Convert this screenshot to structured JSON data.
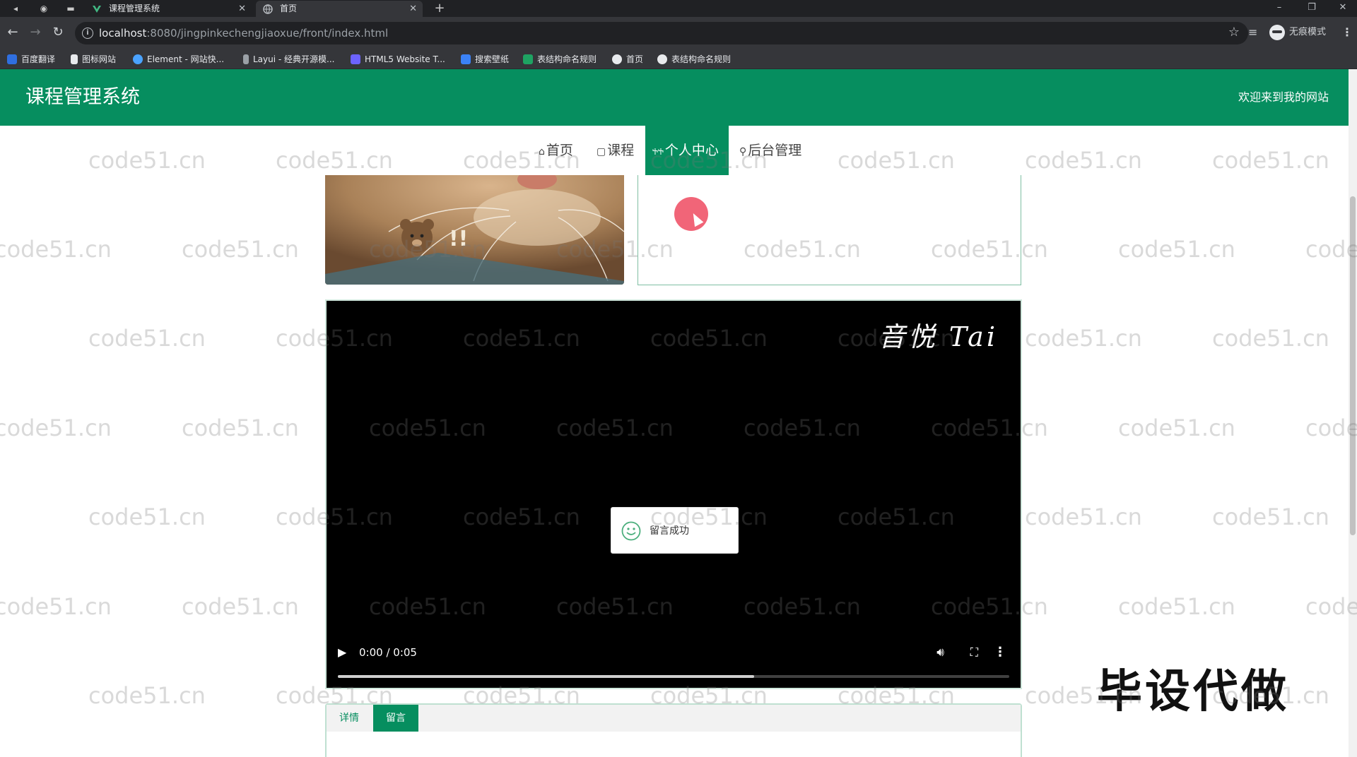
{
  "browser": {
    "tabs": [
      {
        "title": "课程管理系统",
        "active": false
      },
      {
        "title": "首页",
        "active": true
      }
    ],
    "new_tab": "+",
    "url_host": "localhost",
    "url_rest": ":8080/jingpinkechengjiaoxue/front/index.html",
    "incognito_label": "无痕模式",
    "bookmarks": [
      {
        "label": "百度翻译",
        "color": "#2f6fe0"
      },
      {
        "label": "图标网站",
        "color": "#e8eaed"
      },
      {
        "label": "Element - 网站快...",
        "color": "#4aa3ff"
      },
      {
        "label": "Layui - 经典开源模...",
        "color": "#9aa0a6"
      },
      {
        "label": "HTML5 Website T...",
        "color": "#6c63ff"
      },
      {
        "label": "搜索壁纸",
        "color": "#3b82f6"
      },
      {
        "label": "表结构命名规则",
        "color": "#1ea362"
      },
      {
        "label": "首页",
        "color": "#e8eaed"
      },
      {
        "label": "表结构命名规则",
        "color": "#e8eaed"
      }
    ]
  },
  "site": {
    "title": "课程管理系统",
    "welcome": "欢迎来到我的网站",
    "brand_color": "#068e5f",
    "nav": [
      {
        "icon": "home-icon",
        "glyph": "⌂",
        "label": "首页",
        "active": false
      },
      {
        "icon": "course-icon",
        "glyph": "▢",
        "label": "课程",
        "active": false
      },
      {
        "icon": "user-icon",
        "glyph": "ႵႵ",
        "label": "个人中心",
        "active": true
      },
      {
        "icon": "link-icon",
        "glyph": "⚲",
        "label": "后台管理",
        "active": false
      }
    ]
  },
  "video": {
    "signature": "音悦 Tai",
    "time": "0:00 / 0:05",
    "buffered_fraction": 0.62
  },
  "toast": {
    "message": "留言成功"
  },
  "detail_tabs": [
    {
      "label": "详情",
      "active": false
    },
    {
      "label": "留言",
      "active": true
    }
  ],
  "watermark_text": "code51.cn",
  "promo_text": "毕设代做"
}
